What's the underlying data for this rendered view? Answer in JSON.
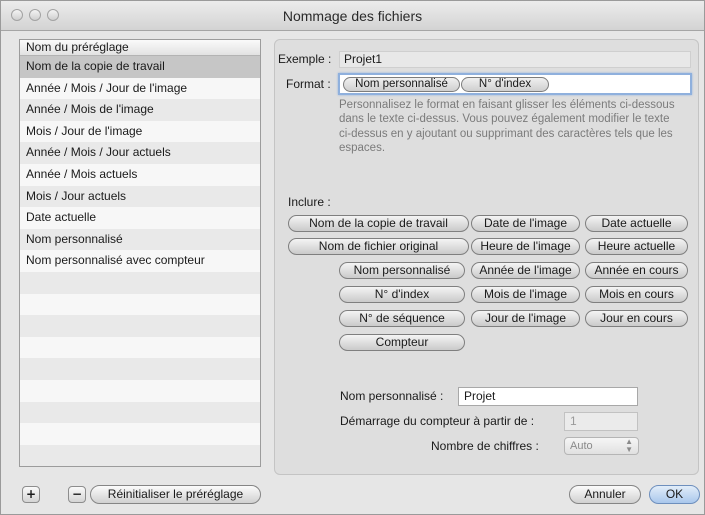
{
  "window": {
    "title": "Nommage des fichiers"
  },
  "presets": {
    "header": "Nom du préréglage",
    "items": [
      "Nom de la copie de travail",
      "Année / Mois / Jour de l'image",
      "Année / Mois de l'image",
      "Mois / Jour de l'image",
      "Année / Mois / Jour actuels",
      "Année / Mois actuels",
      "Mois / Jour actuels",
      "Date actuelle",
      "Nom personnalisé",
      "Nom personnalisé avec compteur"
    ],
    "selected_index": 0
  },
  "example": {
    "label": "Exemple :",
    "value": "Projet1"
  },
  "format": {
    "label": "Format :",
    "tokens": [
      "Nom personnalisé",
      "N° d'index"
    ]
  },
  "help_text": "Personnalisez le format en faisant glisser les éléments ci-dessous dans le texte ci-dessus. Vous pouvez également modifier le texte ci-dessus en y ajoutant ou supprimant des caractères tels que les espaces.",
  "include": {
    "label": "Inclure :",
    "col1": [
      "Nom de la copie de travail",
      "Nom de fichier original",
      "Nom personnalisé",
      "N° d'index",
      "N° de séquence",
      "Compteur"
    ],
    "col2": [
      "Date de l'image",
      "Heure de l'image",
      "Année de l'image",
      "Mois de l'image",
      "Jour de l'image"
    ],
    "col3": [
      "Date actuelle",
      "Heure actuelle",
      "Année en cours",
      "Mois en cours",
      "Jour en cours"
    ]
  },
  "custom_name": {
    "label": "Nom personnalisé :",
    "value": "Projet"
  },
  "counter_start": {
    "label": "Démarrage du compteur à partir de :",
    "value": "1"
  },
  "digits": {
    "label": "Nombre de chiffres :",
    "value": "Auto"
  },
  "footer": {
    "add": "+",
    "remove": "−",
    "reset": "Réinitialiser le préréglage",
    "cancel": "Annuler",
    "ok": "OK"
  }
}
